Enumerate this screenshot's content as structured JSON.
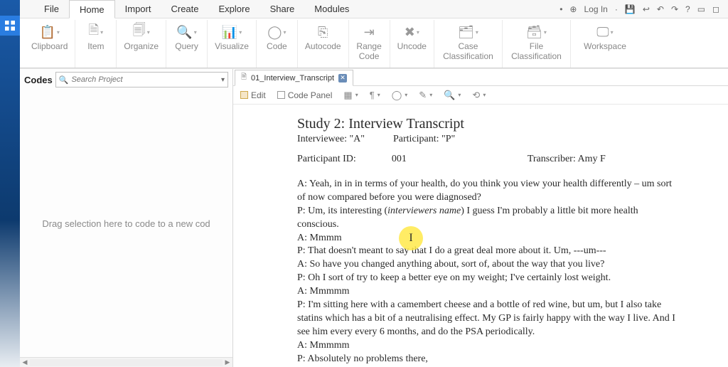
{
  "menubar": {
    "items": [
      "File",
      "Home",
      "Import",
      "Create",
      "Explore",
      "Share",
      "Modules"
    ],
    "active_index": 1,
    "right": {
      "login": "Log In"
    }
  },
  "ribbon": [
    {
      "name": "clipboard",
      "label": "Clipboard",
      "icon": "📋"
    },
    {
      "name": "item",
      "label": "Item",
      "icon": "🗎"
    },
    {
      "name": "organize",
      "label": "Organize",
      "icon": "🗐"
    },
    {
      "name": "query",
      "label": "Query",
      "icon": "🔍"
    },
    {
      "name": "visualize",
      "label": "Visualize",
      "icon": "📊"
    },
    {
      "name": "code",
      "label": "Code",
      "icon": "◯"
    },
    {
      "name": "autocode",
      "label": "Autocode",
      "icon": "⎘"
    },
    {
      "name": "range-code",
      "label": "Range\nCode",
      "icon": "⇥"
    },
    {
      "name": "uncode",
      "label": "Uncode",
      "icon": "✖"
    },
    {
      "name": "case-classification",
      "label": "Case\nClassification",
      "icon": "🗂"
    },
    {
      "name": "file-classification",
      "label": "File\nClassification",
      "icon": "🗃"
    },
    {
      "name": "workspace",
      "label": "Workspace",
      "icon": "🖵"
    }
  ],
  "codes_panel": {
    "title": "Codes",
    "search_placeholder": "Search Project",
    "empty_hint": "Drag selection here to code to a new cod"
  },
  "document": {
    "tab_label": "01_Interview_Transcript",
    "toolbar": {
      "edit": "Edit",
      "code_panel": "Code Panel"
    },
    "title": "Study 2: Interview Transcript",
    "interviewee_label": "Interviewee: \"A\"",
    "participant_label": "Participant: \"P\"",
    "pid_label": "Participant ID:",
    "pid_value": "001",
    "transcriber_label": "Transcriber: Amy F",
    "lines": [
      "A: Yeah, in in in terms of your health, do you think you view your health differently – um sort of now compared before you were diagnosed?",
      "P: Um, its interesting (interviewers name) I guess I'm probably a little bit more health conscious.",
      "A: Mmmm",
      "P: That doesn't meant to say that I do a great deal more about it. Um, ---um---",
      "A: So have you changed anything about, sort of, about the way that you live?",
      "P: Oh I sort of try to keep a better eye on my weight; I've certainly lost weight.",
      "A: Mmmmm",
      "P: I'm sitting here with a camembert cheese and a bottle of red wine, but um, but I also take statins which has a bit of a neutralising effect. My GP is fairly happy with the way I live. And I see him every every 6 months, and do the PSA periodically.",
      "A: Mmmmm",
      "P: Absolutely no problems there,"
    ]
  }
}
